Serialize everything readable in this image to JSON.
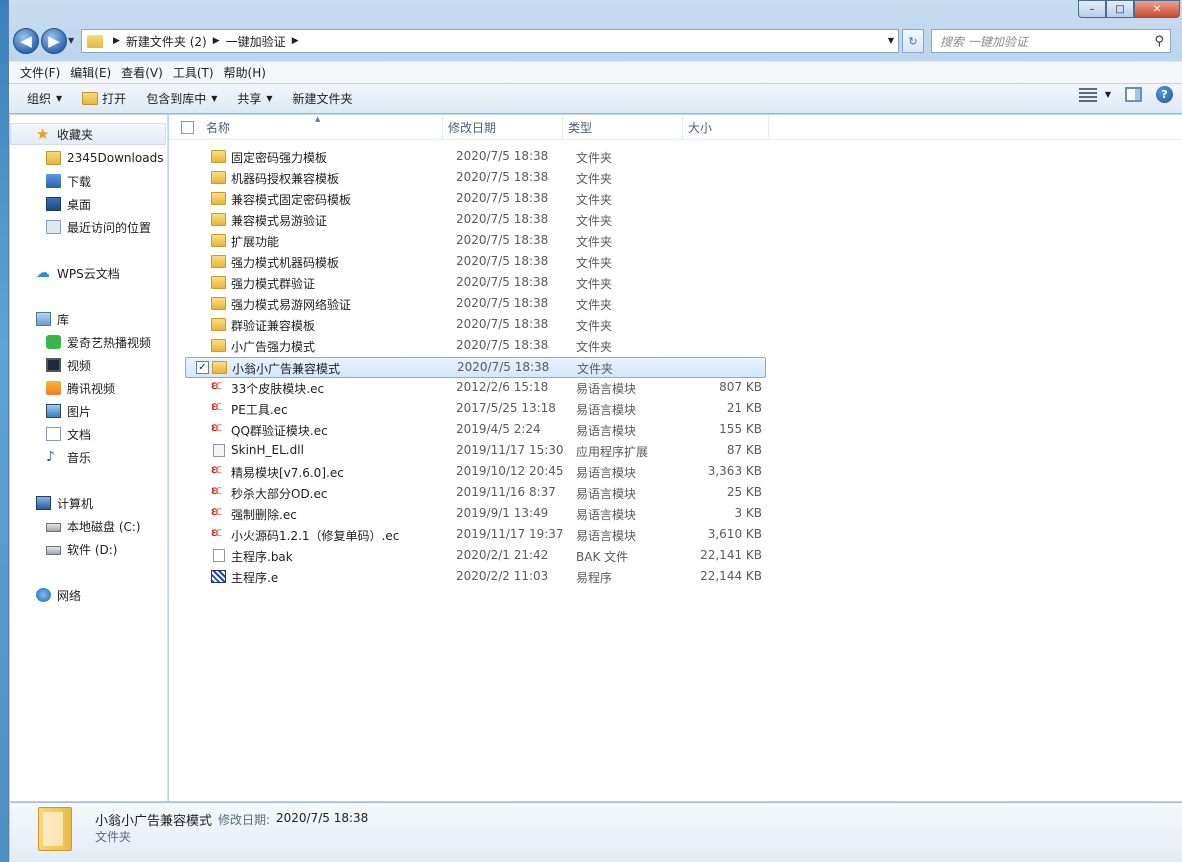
{
  "window": {
    "caption_buttons": [
      "–",
      "□",
      "✕"
    ]
  },
  "address": {
    "crumbs": [
      "新建文件夹 (2)",
      "一键加验证"
    ],
    "search_placeholder": "搜索 一键加验证"
  },
  "menu": [
    "文件(F)",
    "编辑(E)",
    "查看(V)",
    "工具(T)",
    "帮助(H)"
  ],
  "toolbar": {
    "organize": "组织",
    "open": "打开",
    "include_library": "包含到库中",
    "share": "共享",
    "new_folder": "新建文件夹"
  },
  "nav": {
    "favorites": "收藏夹",
    "fav_items": [
      "2345Downloads",
      "下载",
      "桌面",
      "最近访问的位置"
    ],
    "wps": "WPS云文档",
    "library": "库",
    "lib_items": [
      "爱奇艺热播视频",
      "视频",
      "腾讯视频",
      "图片",
      "文档",
      "音乐"
    ],
    "computer": "计算机",
    "drives": [
      "本地磁盘 (C:)",
      "软件 (D:)"
    ],
    "network": "网络"
  },
  "columns": {
    "name": "名称",
    "date": "修改日期",
    "type": "类型",
    "size": "大小"
  },
  "files": [
    {
      "name": "固定密码强力模板",
      "date": "2020/7/5 18:38",
      "type": "文件夹",
      "size": "",
      "icon": "folder-icon"
    },
    {
      "name": "机器码授权兼容模板",
      "date": "2020/7/5 18:38",
      "type": "文件夹",
      "size": "",
      "icon": "folder-icon"
    },
    {
      "name": "兼容模式固定密码模板",
      "date": "2020/7/5 18:38",
      "type": "文件夹",
      "size": "",
      "icon": "folder-icon"
    },
    {
      "name": "兼容模式易游验证",
      "date": "2020/7/5 18:38",
      "type": "文件夹",
      "size": "",
      "icon": "folder-icon"
    },
    {
      "name": "扩展功能",
      "date": "2020/7/5 18:38",
      "type": "文件夹",
      "size": "",
      "icon": "folder-icon"
    },
    {
      "name": "强力模式机器码模板",
      "date": "2020/7/5 18:38",
      "type": "文件夹",
      "size": "",
      "icon": "folder-icon"
    },
    {
      "name": "强力模式群验证",
      "date": "2020/7/5 18:38",
      "type": "文件夹",
      "size": "",
      "icon": "folder-icon"
    },
    {
      "name": "强力模式易游网络验证",
      "date": "2020/7/5 18:38",
      "type": "文件夹",
      "size": "",
      "icon": "folder-icon"
    },
    {
      "name": "群验证兼容模板",
      "date": "2020/7/5 18:38",
      "type": "文件夹",
      "size": "",
      "icon": "folder-icon"
    },
    {
      "name": "小广告强力模式",
      "date": "2020/7/5 18:38",
      "type": "文件夹",
      "size": "",
      "icon": "folder-icon"
    },
    {
      "name": "小翁小广告兼容模式",
      "date": "2020/7/5 18:38",
      "type": "文件夹",
      "size": "",
      "icon": "folder-icon",
      "selected": true
    },
    {
      "name": "33个皮肤模块.ec",
      "date": "2012/2/6 15:18",
      "type": "易语言模块",
      "size": "807 KB",
      "icon": "ec-module-icon"
    },
    {
      "name": "PE工具.ec",
      "date": "2017/5/25 13:18",
      "type": "易语言模块",
      "size": "21 KB",
      "icon": "ec-module-icon"
    },
    {
      "name": "QQ群验证模块.ec",
      "date": "2019/4/5 2:24",
      "type": "易语言模块",
      "size": "155 KB",
      "icon": "ec-module-icon"
    },
    {
      "name": "SkinH_EL.dll",
      "date": "2019/11/17 15:30",
      "type": "应用程序扩展",
      "size": "87 KB",
      "icon": "dll-file-icon"
    },
    {
      "name": "精易模块[v7.6.0].ec",
      "date": "2019/10/12 20:45",
      "type": "易语言模块",
      "size": "3,363 KB",
      "icon": "ec-module-icon"
    },
    {
      "name": "秒杀大部分OD.ec",
      "date": "2019/11/16 8:37",
      "type": "易语言模块",
      "size": "25 KB",
      "icon": "ec-module-icon"
    },
    {
      "name": "强制删除.ec",
      "date": "2019/9/1 13:49",
      "type": "易语言模块",
      "size": "3 KB",
      "icon": "ec-module-icon"
    },
    {
      "name": "小火源码1.2.1（修复单码）.ec",
      "date": "2019/11/17 19:37",
      "type": "易语言模块",
      "size": "3,610 KB",
      "icon": "ec-module-icon"
    },
    {
      "name": "主程序.bak",
      "date": "2020/2/1 21:42",
      "type": "BAK 文件",
      "size": "22,141 KB",
      "icon": "bak-file-icon"
    },
    {
      "name": "主程序.e",
      "date": "2020/2/2 11:03",
      "type": "易程序",
      "size": "22,144 KB",
      "icon": "e-program-icon"
    }
  ],
  "details": {
    "name": "小翁小广告兼容模式",
    "modified_label": "修改日期:",
    "modified_value": "2020/7/5 18:38",
    "type": "文件夹"
  }
}
